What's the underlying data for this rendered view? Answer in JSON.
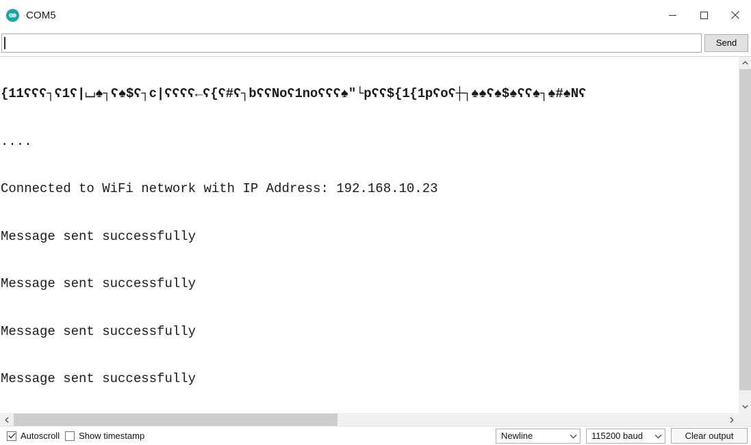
{
  "window": {
    "title": "COM5",
    "logo_icon": "arduino-logo-icon",
    "controls": {
      "minimize_icon": "minimize-icon",
      "maximize_icon": "maximize-icon",
      "close_icon": "close-icon"
    }
  },
  "send_bar": {
    "input_value": "",
    "input_placeholder": "",
    "send_label": "Send"
  },
  "console": {
    "lines": [
      "{11ʕʕʕ┐ʕ1ʕ|⌴♠┐ʕ♠$ʕ┐c|ʕʕʕʕ←ʕ{ʕ#ʕ┐bʕʕNoʕ1noʕʕʕ♠\"└pʕʕ${1{1pʕoʕ┼┐♠♠ʕ♠$♠ʕʕ♠┐♠#♠Nʕ",
      "....",
      "Connected to WiFi network with IP Address: 192.168.10.23",
      "Message sent successfully",
      "Message sent successfully",
      "Message sent successfully",
      "Message sent successfully"
    ]
  },
  "scrollbars": {
    "vertical_up_icon": "chevron-up-icon",
    "vertical_down_icon": "chevron-down-icon",
    "horizontal_left_icon": "chevron-left-icon",
    "horizontal_right_icon": "chevron-right-icon"
  },
  "status_bar": {
    "autoscroll_label": "Autoscroll",
    "autoscroll_checked": true,
    "timestamp_label": "Show timestamp",
    "timestamp_checked": false,
    "line_ending_value": "Newline",
    "baud_value": "115200 baud",
    "clear_label": "Clear output",
    "dropdown_icon": "chevron-down-icon"
  },
  "colors": {
    "accent": "#1aa6a6",
    "text": "#1a1a1a",
    "chrome": "#f0f0f0",
    "scroll_thumb": "#cdcdcd"
  }
}
